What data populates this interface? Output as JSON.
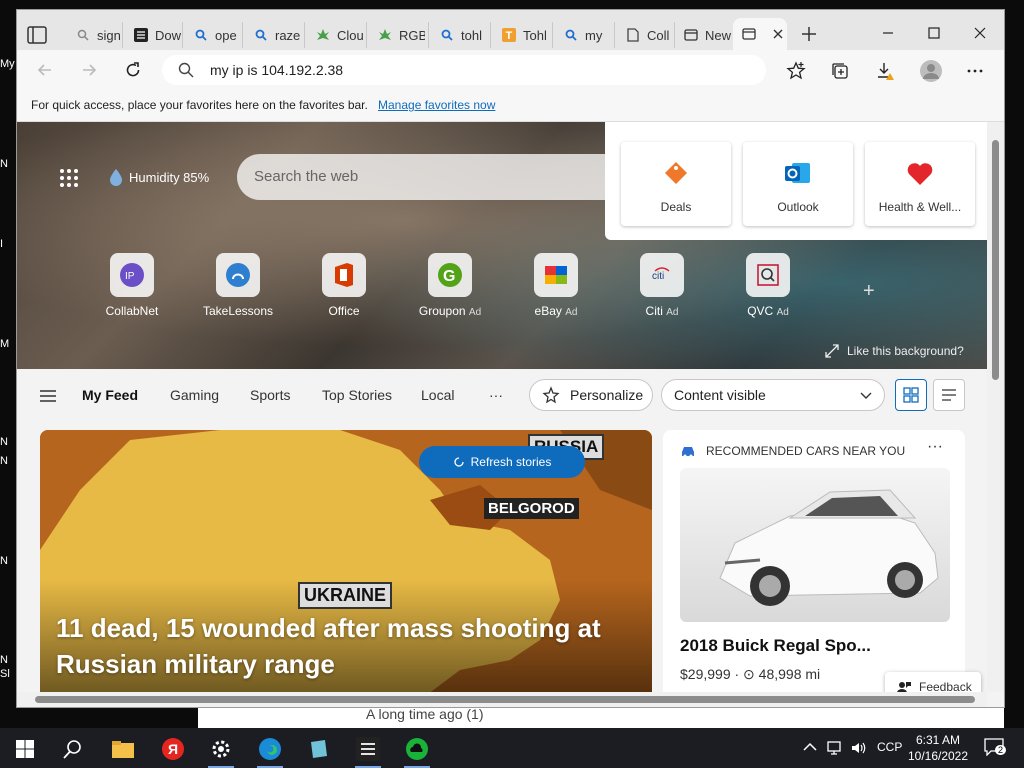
{
  "desktop": {
    "sliver_letters": [
      "My",
      "N",
      "I",
      "M",
      "N",
      "N",
      "N",
      "N",
      "Sl"
    ],
    "under_window_text": "A long time ago (1)"
  },
  "tabs": [
    {
      "icon": "search-icon",
      "label": "sign"
    },
    {
      "icon": "app-icon",
      "label": "Dow"
    },
    {
      "icon": "search-icon",
      "label": "ope"
    },
    {
      "icon": "search-icon",
      "label": "raze"
    },
    {
      "icon": "leaf-icon",
      "label": "Clou"
    },
    {
      "icon": "leaf-icon",
      "label": "RGB"
    },
    {
      "icon": "search-icon",
      "label": "tohl"
    },
    {
      "icon": "t-icon",
      "label": "Tohl"
    },
    {
      "icon": "search-icon",
      "label": "my"
    },
    {
      "icon": "page-icon",
      "label": "Coll"
    },
    {
      "icon": "newtab-icon",
      "label": "New"
    }
  ],
  "address": {
    "url": "my ip is 104.192.2.38"
  },
  "favorites_bar": {
    "message": "For quick access, place your favorites here on the favorites bar.",
    "link": "Manage favorites now"
  },
  "newtab": {
    "weather": "Humidity 85%",
    "search_placeholder": "Search the web",
    "quick_links": [
      {
        "name": "CollabNet",
        "ad": ""
      },
      {
        "name": "TakeLessons",
        "ad": ""
      },
      {
        "name": "Office",
        "ad": ""
      },
      {
        "name": "Groupon",
        "ad": "Ad"
      },
      {
        "name": "eBay",
        "ad": "Ad"
      },
      {
        "name": "Citi",
        "ad": "Ad"
      },
      {
        "name": "QVC",
        "ad": "Ad"
      }
    ],
    "like_background": "Like this background?",
    "top_sites": [
      "Deals",
      "Outlook",
      "Health & Well..."
    ]
  },
  "feed": {
    "nav": [
      "My Feed",
      "Gaming",
      "Sports",
      "Top Stories",
      "Local"
    ],
    "personalize": "Personalize",
    "content_select": "Content visible",
    "refresh": "Refresh stories",
    "map_labels": {
      "russia": "RUSSIA",
      "belgorod": "BELGOROD",
      "ukraine": "UKRAINE"
    },
    "headline": "11 dead, 15 wounded after mass shooting at Russian military range",
    "cars": {
      "header": "RECOMMENDED CARS NEAR YOU",
      "title": "2018 Buick Regal Spo...",
      "price": "$29,999",
      "miles": "48,998 mi"
    },
    "feedback": "Feedback"
  },
  "taskbar": {
    "language": "CCP",
    "time": "6:31 AM",
    "date": "10/16/2022",
    "notifications": "2"
  },
  "colors": {
    "accent": "#0f6cbd",
    "map_land": "#e7b945",
    "map_russia": "#b5651d"
  }
}
